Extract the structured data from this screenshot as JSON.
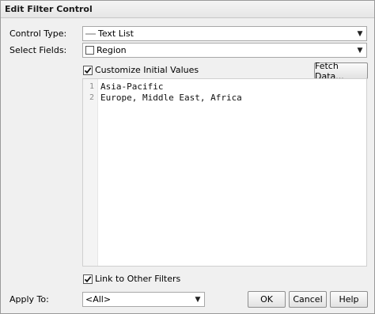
{
  "window": {
    "title": "Edit Filter Control"
  },
  "control_type": {
    "label": "Control Type:",
    "value": "Text List"
  },
  "select_fields": {
    "label": "Select Fields:",
    "value": "Region"
  },
  "customize": {
    "label": "Customize Initial Values",
    "checked": true
  },
  "fetch_button": {
    "label": "Fetch Data..."
  },
  "editor": {
    "lines": [
      {
        "number": "1",
        "text": "Asia-Pacific"
      },
      {
        "number": "2",
        "text": "Europe, Middle East, Africa"
      }
    ]
  },
  "link_filters": {
    "label": "Link to Other Filters",
    "checked": true
  },
  "apply_to": {
    "label": "Apply To:",
    "value": "<All>"
  },
  "buttons": {
    "ok": "OK",
    "cancel": "Cancel",
    "help": "Help"
  },
  "icons": {
    "dropdown": "chevron-down-icon",
    "checkmark": "checkmark-icon",
    "text_list": "text-list-icon",
    "field": "field-icon"
  }
}
